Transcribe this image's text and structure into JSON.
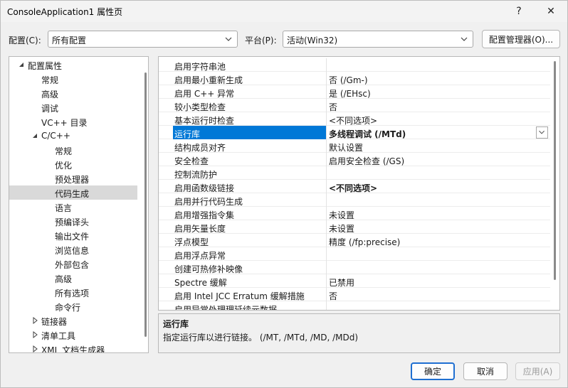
{
  "window": {
    "title": "ConsoleApplication1 属性页",
    "help_glyph": "?",
    "close_glyph": "✕"
  },
  "config": {
    "config_label": "配置(C):",
    "config_value": "所有配置",
    "platform_label": "平台(P):",
    "platform_value": "活动(Win32)",
    "manager_button": "配置管理器(O)..."
  },
  "tree": {
    "items": [
      {
        "label": "配置属性",
        "level": 0,
        "expander": "expanded"
      },
      {
        "label": "常规",
        "level": 1,
        "expander": "none"
      },
      {
        "label": "高级",
        "level": 1,
        "expander": "none"
      },
      {
        "label": "调试",
        "level": 1,
        "expander": "none"
      },
      {
        "label": "VC++ 目录",
        "level": 1,
        "expander": "none"
      },
      {
        "label": "C/C++",
        "level": 1,
        "expander": "expanded"
      },
      {
        "label": "常规",
        "level": 2,
        "expander": "none"
      },
      {
        "label": "优化",
        "level": 2,
        "expander": "none"
      },
      {
        "label": "预处理器",
        "level": 2,
        "expander": "none"
      },
      {
        "label": "代码生成",
        "level": 2,
        "expander": "none",
        "selected": true
      },
      {
        "label": "语言",
        "level": 2,
        "expander": "none"
      },
      {
        "label": "预编译头",
        "level": 2,
        "expander": "none"
      },
      {
        "label": "输出文件",
        "level": 2,
        "expander": "none"
      },
      {
        "label": "浏览信息",
        "level": 2,
        "expander": "none"
      },
      {
        "label": "外部包含",
        "level": 2,
        "expander": "none"
      },
      {
        "label": "高级",
        "level": 2,
        "expander": "none"
      },
      {
        "label": "所有选项",
        "level": 2,
        "expander": "none"
      },
      {
        "label": "命令行",
        "level": 2,
        "expander": "none"
      },
      {
        "label": "链接器",
        "level": 1,
        "expander": "collapsed"
      },
      {
        "label": "清单工具",
        "level": 1,
        "expander": "collapsed"
      },
      {
        "label": "XML 文档生成器",
        "level": 1,
        "expander": "collapsed"
      }
    ]
  },
  "properties": [
    {
      "name": "启用字符串池",
      "value": ""
    },
    {
      "name": "启用最小重新生成",
      "value": "否 (/Gm-)"
    },
    {
      "name": "启用 C++ 异常",
      "value": "是 (/EHsc)"
    },
    {
      "name": "较小类型检查",
      "value": "否"
    },
    {
      "name": "基本运行时检查",
      "value": "<不同选项>"
    },
    {
      "name": "运行库",
      "value": "多线程调试 (/MTd)",
      "selected": true,
      "bold": true
    },
    {
      "name": "结构成员对齐",
      "value": "默认设置"
    },
    {
      "name": "安全检查",
      "value": "启用安全检查 (/GS)"
    },
    {
      "name": "控制流防护",
      "value": ""
    },
    {
      "name": "启用函数级链接",
      "value": "<不同选项>",
      "bold": true
    },
    {
      "name": "启用并行代码生成",
      "value": ""
    },
    {
      "name": "启用增强指令集",
      "value": "未设置"
    },
    {
      "name": "启用矢量长度",
      "value": "未设置"
    },
    {
      "name": "浮点模型",
      "value": "精度 (/fp:precise)"
    },
    {
      "name": "启用浮点异常",
      "value": ""
    },
    {
      "name": "创建可热修补映像",
      "value": ""
    },
    {
      "name": "Spectre 缓解",
      "value": "已禁用"
    },
    {
      "name": "启用 Intel JCC Erratum 缓解措施",
      "value": "否"
    },
    {
      "name": "启用异常处理理延续元数据",
      "value": ""
    }
  ],
  "description": {
    "title": "运行库",
    "text": "指定运行库以进行链接。     (/MT, /MTd, /MD, /MDd)"
  },
  "buttons": {
    "ok": "确定",
    "cancel": "取消",
    "apply": "应用(A)"
  },
  "colors": {
    "selection": "#0078d7",
    "tree_selection": "#d9d9d9",
    "primary_border": "#1f6fd1"
  }
}
